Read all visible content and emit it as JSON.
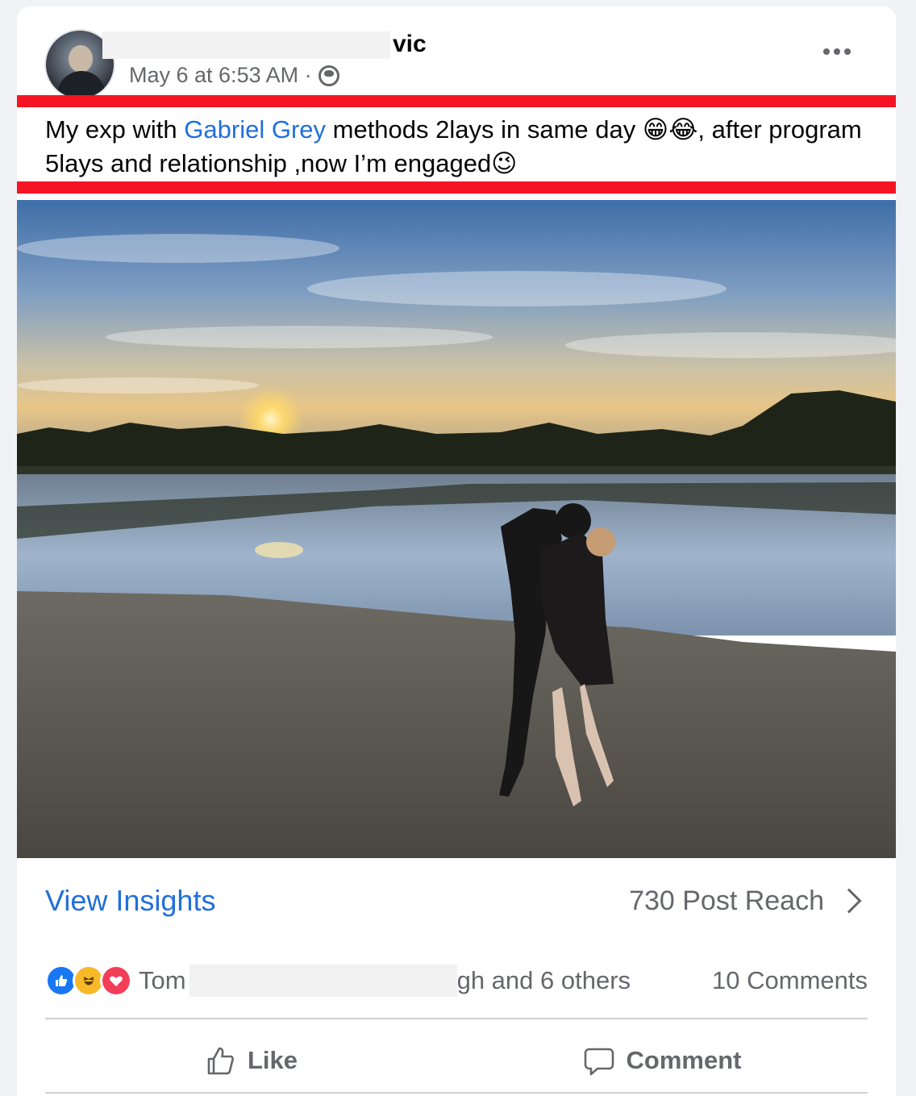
{
  "post": {
    "author_suffix": "vic",
    "timestamp": "May 6 at 6:53 AM ·",
    "privacy_icon": "friends-icon",
    "text_before_link": "My exp with ",
    "link_text": "Gabriel Grey",
    "text_after_link": " methods 2lays in same day 😁😂, after program 5lays and relationship ,now I’m engaged😉"
  },
  "insights": {
    "view_label": "View Insights",
    "reach_label": "730 Post Reach"
  },
  "reactions": {
    "names_start": "Tom",
    "names_end": "gh and 6 others",
    "comments": "10 Comments"
  },
  "actions": {
    "like": "Like",
    "comment": "Comment"
  },
  "colors": {
    "link": "#216fdb",
    "highlight_border": "#f51424",
    "secondary_text": "#65676b"
  }
}
